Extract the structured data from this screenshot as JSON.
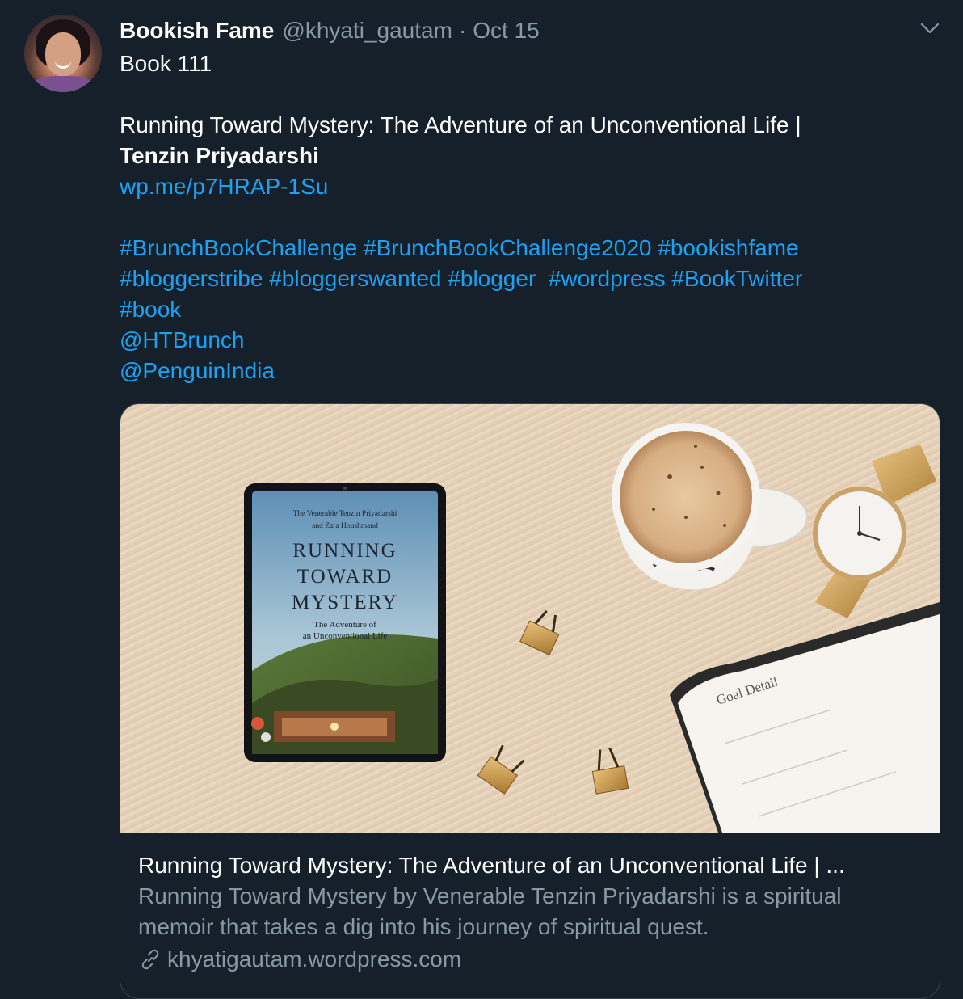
{
  "tweet": {
    "author_name": "Bookish Fame",
    "author_handle": "@khyati_gautam",
    "separator": "·",
    "date": "Oct 15",
    "lines": [
      "Book 111",
      "Running Toward Mystery: The Adventure of an Unconventional Life |",
      "Tenzin Priyadarshi"
    ],
    "url": "wp.me/p7HRAP-1Su",
    "hashtags_line1": [
      "#BrunchBookChallenge",
      "#BrunchBookChallenge2020",
      "#bookishfame"
    ],
    "hashtags_line2": [
      "#bloggerstribe",
      "#bloggerswanted",
      "#blogger",
      "#wordpress",
      "#BookTwitter"
    ],
    "hashtags_line3": [
      "#book"
    ],
    "mentions": [
      "@HTBrunch",
      "@PenguinIndia"
    ]
  },
  "card": {
    "image": {
      "tablet_author": "The Venerable Tenzin Priyadarshi",
      "tablet_coauthor": "and Zara Houshmand",
      "tablet_title_1": "RUNNING",
      "tablet_title_2": "TOWARD",
      "tablet_title_3": "MYSTERY",
      "tablet_subtitle_1": "The Adventure of",
      "tablet_subtitle_2": "an Unconventional Life",
      "notebook_heading": "Goal Detail"
    },
    "title": "Running Toward Mystery: The Adventure of an Unconventional Life | ...",
    "description_line1": "Running Toward Mystery by Venerable Tenzin Priyadarshi is a spiritual",
    "description_line2": "memoir that takes a dig into his journey of spiritual quest.",
    "domain": "khyatigautam.wordpress.com"
  },
  "icons": {
    "menu": "chevron-down-icon",
    "domain": "link-icon"
  },
  "colors": {
    "background": "#15202b",
    "link": "#1da1f2",
    "secondary_text": "#8899a6",
    "border": "#38444d"
  }
}
